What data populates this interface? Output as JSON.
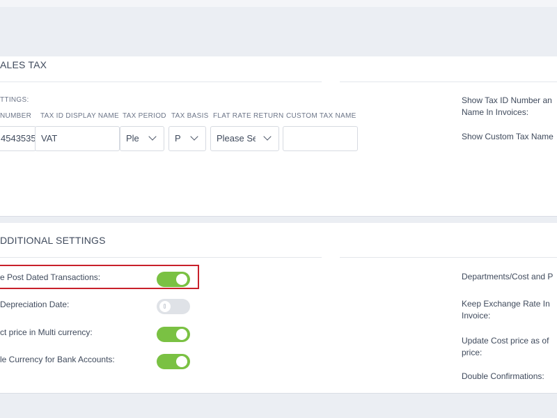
{
  "sales_tax": {
    "title": "ALES TAX",
    "settings_label": "TTINGS:",
    "columns": {
      "tax_number": "NUMBER",
      "display_name": "TAX ID DISPLAY NAME",
      "tax_period": "TAX PERIOD",
      "tax_basis": "TAX BASIS",
      "flat_rate_return": "FLAT RATE RETURN",
      "custom_tax_name": "CUSTOM TAX NAME"
    },
    "values": {
      "tax_number": "4543535",
      "display_name": "VAT",
      "tax_period": "Ple",
      "tax_basis": "P",
      "flat_rate_return": "Please Se",
      "custom_tax_name": ""
    },
    "right": {
      "show_tax_id_line1": "Show Tax ID Number an",
      "show_tax_id_line2": "Name In Invoices:",
      "show_custom_tax": "Show Custom Tax Name"
    }
  },
  "additional_settings": {
    "title": "DDITIONAL SETTINGS",
    "items": [
      {
        "label": "e Post Dated Transactions:",
        "state": "on"
      },
      {
        "label": "Depreciation Date:",
        "state": "off"
      },
      {
        "label": "ct price in Multi currency:",
        "state": "on"
      },
      {
        "label": "le Currency for Bank Accounts:",
        "state": "on"
      }
    ],
    "right": {
      "departments": "Departments/Cost and P",
      "keep_exchange_line1": "Keep Exchange Rate In",
      "keep_exchange_line2": "Invoice:",
      "update_cost_line1": "Update Cost price as of",
      "update_cost_line2": "price:",
      "double_confirmations": "Double Confirmations:"
    }
  },
  "colors": {
    "toggle_on": "#7ac143",
    "toggle_off": "#dfe2e7",
    "highlight": "#c8202a",
    "background": "#ebeef3"
  }
}
